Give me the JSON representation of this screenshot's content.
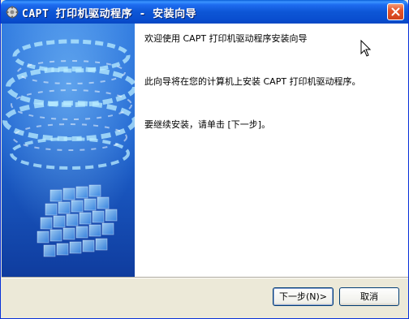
{
  "window": {
    "title": "CAPT 打印机驱动程序 - 安装向导"
  },
  "content": {
    "welcome": "欢迎使用 CAPT 打印机驱动程序安装向导",
    "description": "此向导将在您的计算机上安装 CAPT 打印机驱动程序。",
    "instruction": "要继续安装，请单击 [下一步]。"
  },
  "buttons": {
    "next": "下一步(N)>",
    "cancel": "取消"
  },
  "colors": {
    "titlebar": "#0a4fd0",
    "sidebar_blue": "#1d5fc8",
    "close_button": "#e5542a",
    "dialog_bg": "#ece9d8"
  }
}
